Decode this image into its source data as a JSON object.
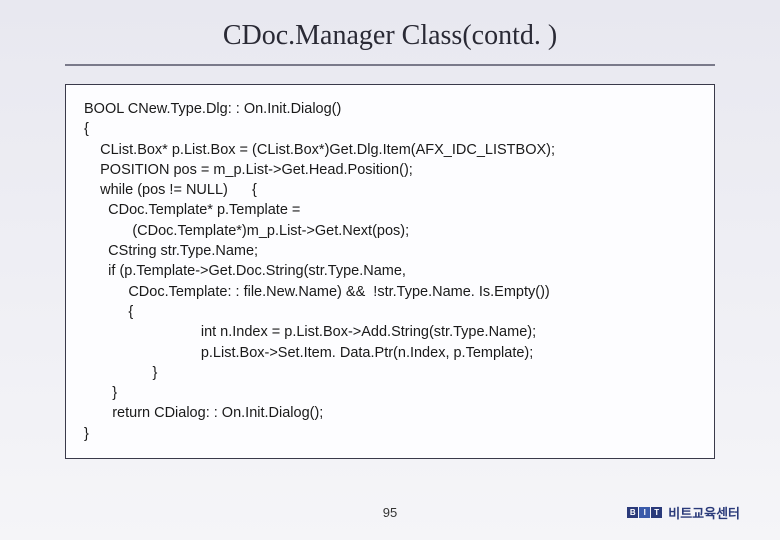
{
  "title": "CDoc.Manager Class(contd. )",
  "code": {
    "line1": "BOOL CNew.Type.Dlg: : On.Init.Dialog()",
    "line2": "{",
    "line3": "    CList.Box* p.List.Box = (CList.Box*)Get.Dlg.Item(AFX_IDC_LISTBOX);",
    "line4": "    POSITION pos = m_p.List->Get.Head.Position();",
    "line5": "    while (pos != NULL)      {",
    "line6": "      CDoc.Template* p.Template =",
    "line7": "            (CDoc.Template*)m_p.List->Get.Next(pos);",
    "line8": "      CString str.Type.Name;",
    "line9": "      if (p.Template->Get.Doc.String(str.Type.Name,",
    "line10": "           CDoc.Template: : file.New.Name) &&  !str.Type.Name. Is.Empty())",
    "line11": "           {",
    "line12": "                             int n.Index = p.List.Box->Add.String(str.Type.Name);",
    "line13": "                             p.List.Box->Set.Item. Data.Ptr(n.Index, p.Template);",
    "line14": "                 }",
    "line15": "       }",
    "line16": "       return CDialog: : On.Init.Dialog();",
    "line17": "}"
  },
  "page_number": "95",
  "logo": {
    "b": "B",
    "i": "I",
    "t": "T",
    "text": "비트교육센터"
  }
}
